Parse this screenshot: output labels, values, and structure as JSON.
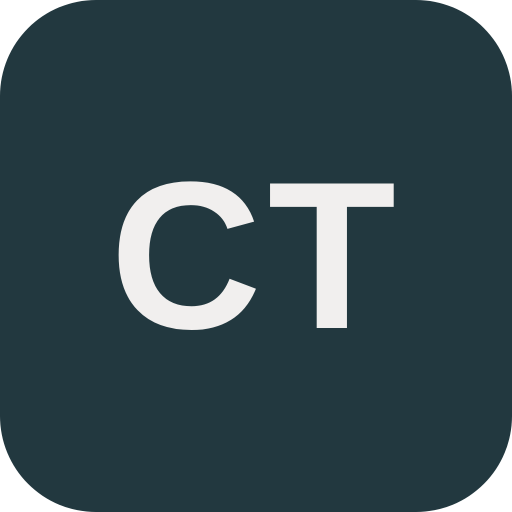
{
  "app_icon": {
    "monogram": "CT",
    "colors": {
      "background": "#22383f",
      "text": "#f1efee"
    }
  }
}
